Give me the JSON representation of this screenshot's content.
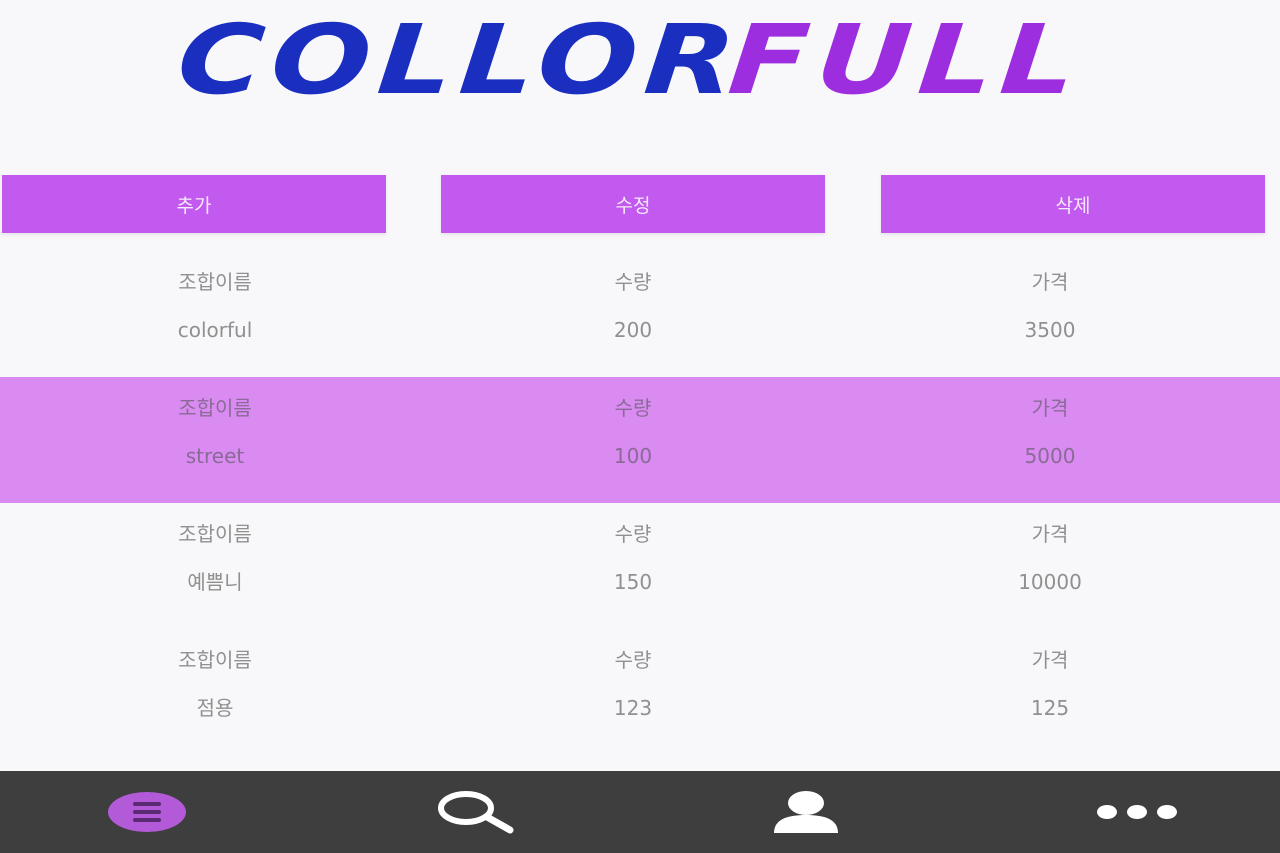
{
  "app": {
    "title_part1": "COLLOR",
    "title_part2": "FULL"
  },
  "actions": {
    "add_label": "추가",
    "edit_label": "수정",
    "delete_label": "삭제"
  },
  "list": {
    "items": [
      {
        "name_label": "조합이름",
        "qty_label": "수량",
        "price_label": "가격",
        "name": "colorful",
        "qty": "200",
        "price": "3500",
        "selected": false
      },
      {
        "name_label": "조합이름",
        "qty_label": "수량",
        "price_label": "가격",
        "name": "street",
        "qty": "100",
        "price": "5000",
        "selected": true
      },
      {
        "name_label": "조합이름",
        "qty_label": "수량",
        "price_label": "가격",
        "name": "예쁨니",
        "qty": "150",
        "price": "10000",
        "selected": false
      },
      {
        "name_label": "조합이름",
        "qty_label": "수량",
        "price_label": "가격",
        "name": "점용",
        "qty": "123",
        "price": "125",
        "selected": false
      }
    ]
  },
  "nav": {
    "icons": [
      "list-icon",
      "search-icon",
      "user-icon",
      "more-icon"
    ],
    "active_color": "#b35ad9",
    "icon_color": "#ffffff"
  },
  "colors": {
    "accent": "#c35af0",
    "selected_row": "#d98bf2",
    "nav_bg": "#3e3e3e",
    "title_blue": "#1a2fc0",
    "title_purple": "#9d2ee0"
  }
}
